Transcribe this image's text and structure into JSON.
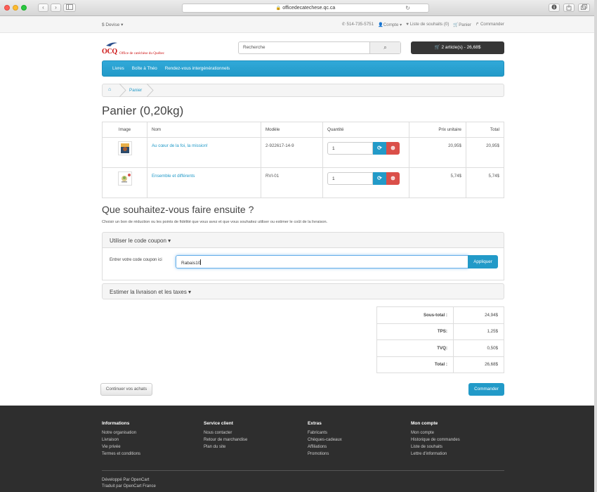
{
  "browser": {
    "url": "officedecatechese.qc.ca",
    "back_glyph": "‹",
    "forward_glyph": "›"
  },
  "topbar": {
    "currency": "$ Devise ▾",
    "phone": "514-735-5751",
    "account": "Compte ▾",
    "wishlist": "Liste de souhaits (0)",
    "cart": "Panier",
    "checkout": "Commander"
  },
  "header": {
    "logo_mark": "OCQ",
    "logo_text": "Office de catéchèse du Québec",
    "search_placeholder": "Recherche",
    "cart_button": "2 article(s) - 26,68$"
  },
  "menu": [
    "Livres",
    "Boîte à Théo",
    "Rendez-vous intergénérationnels"
  ],
  "breadcrumb": {
    "current": "Panier"
  },
  "page_title": "Panier  (0,20kg)",
  "cart": {
    "headers": [
      "Image",
      "Nom",
      "Modèle",
      "Quantité",
      "Prix unitaire",
      "Total"
    ],
    "rows": [
      {
        "name": "Au cœur de la foi, la mission!",
        "model": "2-922617-14-9",
        "qty": "1",
        "price": "20,95$",
        "total": "20,95$"
      },
      {
        "name": "Ensemble et différents",
        "model": "RVI-01",
        "qty": "1",
        "price": "5,74$",
        "total": "5,74$"
      }
    ]
  },
  "next": {
    "title": "Que souhaitez-vous faire ensuite ?",
    "description": "Choisir un bon de réduction ou les points de fidélité que vous avez et que vous souhaitez utiliser ou estimer le coût de la livraison."
  },
  "coupon": {
    "panel_title": "Utiliser le code coupon ▾",
    "label": "Entrer votre code coupon ici",
    "value": "Rabais10",
    "button": "Appliquer"
  },
  "shipping": {
    "panel_title": "Estimer la livraison et les taxes ▾"
  },
  "totals": [
    {
      "label": "Sous-total :",
      "value": "24,94$"
    },
    {
      "label": "TPS:",
      "value": "1,25$"
    },
    {
      "label": "TVQ:",
      "value": "0,50$"
    },
    {
      "label": "Total :",
      "value": "26,68$"
    }
  ],
  "actions": {
    "continue": "Continuer vos achats",
    "checkout": "Commander"
  },
  "footer": {
    "columns": [
      {
        "title": "Informations",
        "links": [
          "Notre organisation",
          "Livraison",
          "Vie privée",
          "Termes et conditions"
        ]
      },
      {
        "title": "Service client",
        "links": [
          "Nous contacter",
          "Retour de marchandise",
          "Plan du site"
        ]
      },
      {
        "title": "Extras",
        "links": [
          "Fabricants",
          "Chèques-cadeaux",
          "Affiliations",
          "Promotions"
        ]
      },
      {
        "title": "Mon compte",
        "links": [
          "Mon compte",
          "Historique de commandes",
          "Liste de souhaits",
          "Lettre d'information"
        ]
      }
    ],
    "credits": [
      "Développé Par OpenCart",
      "Traduit par OpenCart France"
    ]
  },
  "colors": {
    "accent": "#229ac8",
    "danger": "#da4f49",
    "footer": "#2e2e2e",
    "cart_button": "#363636"
  }
}
